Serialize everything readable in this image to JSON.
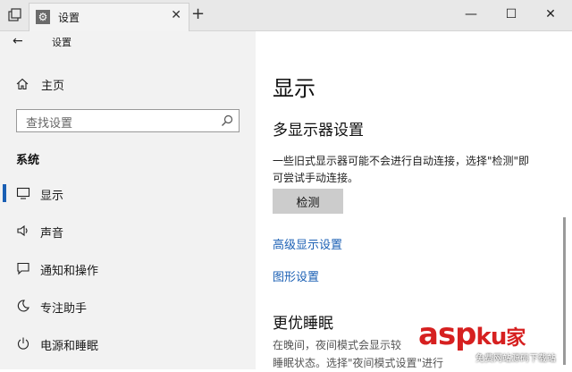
{
  "window": {
    "tab_title": "设置",
    "new_tab_symbol": "+",
    "tab_close_symbol": "✕",
    "minimize_symbol": "—",
    "maximize_symbol": "☐",
    "close_symbol": "✕"
  },
  "sidebar": {
    "back_symbol": "←",
    "header": "设置",
    "home_label": "主页",
    "search_placeholder": "查找设置",
    "section_label": "系统",
    "items": [
      {
        "label": "显示",
        "icon": "monitor-icon",
        "selected": true
      },
      {
        "label": "声音",
        "icon": "speaker-icon",
        "selected": false
      },
      {
        "label": "通知和操作",
        "icon": "notification-icon",
        "selected": false
      },
      {
        "label": "专注助手",
        "icon": "moon-icon",
        "selected": false
      },
      {
        "label": "电源和睡眠",
        "icon": "power-icon",
        "selected": false
      }
    ]
  },
  "main": {
    "title": "显示",
    "multi_display_heading": "多显示器设置",
    "multi_display_desc": "一些旧式显示器可能不会进行自动连接，选择\"检测\"即可尝试手动连接。",
    "detect_button": "检测",
    "link_advanced": "高级显示设置",
    "link_graphics": "图形设置",
    "sleep_heading": "更优睡眠",
    "sleep_desc_line1": "在晚间，夜间模式会显示较",
    "sleep_desc_line2": "睡眠状态。选择\"夜间模式设置\"进行"
  },
  "watermark": {
    "text": "asp",
    "text2": "ku",
    "text3": "家",
    "sub": "免费网站源码下载站"
  },
  "colors": {
    "accent": "#1a5fb4",
    "sidebar_bg": "#f2f2f2",
    "button_bg": "#cccccc",
    "watermark": "#d62020"
  }
}
